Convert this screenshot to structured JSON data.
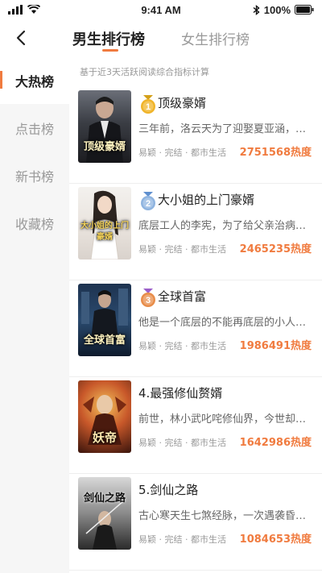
{
  "status": {
    "time": "9:41 AM",
    "battery": "100%"
  },
  "header": {
    "tab_male": "男生排行榜",
    "tab_female": "女生排行榜"
  },
  "sidebar": {
    "items": [
      {
        "label": "大热榜"
      },
      {
        "label": "点击榜"
      },
      {
        "label": "新书榜"
      },
      {
        "label": "收藏榜"
      }
    ]
  },
  "main": {
    "note": "基于近3天活跃阅读综合指标计算",
    "books": [
      {
        "rank": "1",
        "title": "顶级豪婿",
        "cover_title": "顶级豪婿",
        "desc": "三年前，洛云天为了迎娶夏亚涵，离开家族...",
        "meta": "易颖 · 完结 · 都市生活",
        "heat": "2751568热度"
      },
      {
        "rank": "2",
        "title": "大小姐的上门豪婿",
        "cover_title": "大小姐的上门豪婿",
        "desc": "底层工人的李宪，为了给父亲治病成为...",
        "meta": "易颖 · 完结 · 都市生活",
        "heat": "2465235热度"
      },
      {
        "rank": "3",
        "title": "全球首富",
        "cover_title": "全球首富",
        "desc": "他是一个底层的不能再底层的小人物...",
        "meta": "易颖 · 完结 · 都市生活",
        "heat": "1986491热度"
      },
      {
        "title": "4.最强修仙赘婿",
        "cover_title": "妖帝",
        "desc": "前世，林小武叱咤修仙界，今世却意外...",
        "meta": "易颖 · 完结 · 都市生活",
        "heat": "1642986热度"
      },
      {
        "title": "5.剑仙之路",
        "cover_title": "剑仙之路",
        "desc": "古心寒天生七煞经脉，一次遇袭昏死过去...",
        "meta": "易颖 · 完结 · 都市生活",
        "heat": "1084653热度"
      }
    ]
  },
  "colors": {
    "accent": "#f07b3f",
    "gold": "#f0b429",
    "silver": "#8fb4e0",
    "bronze": "#e88d4a"
  }
}
